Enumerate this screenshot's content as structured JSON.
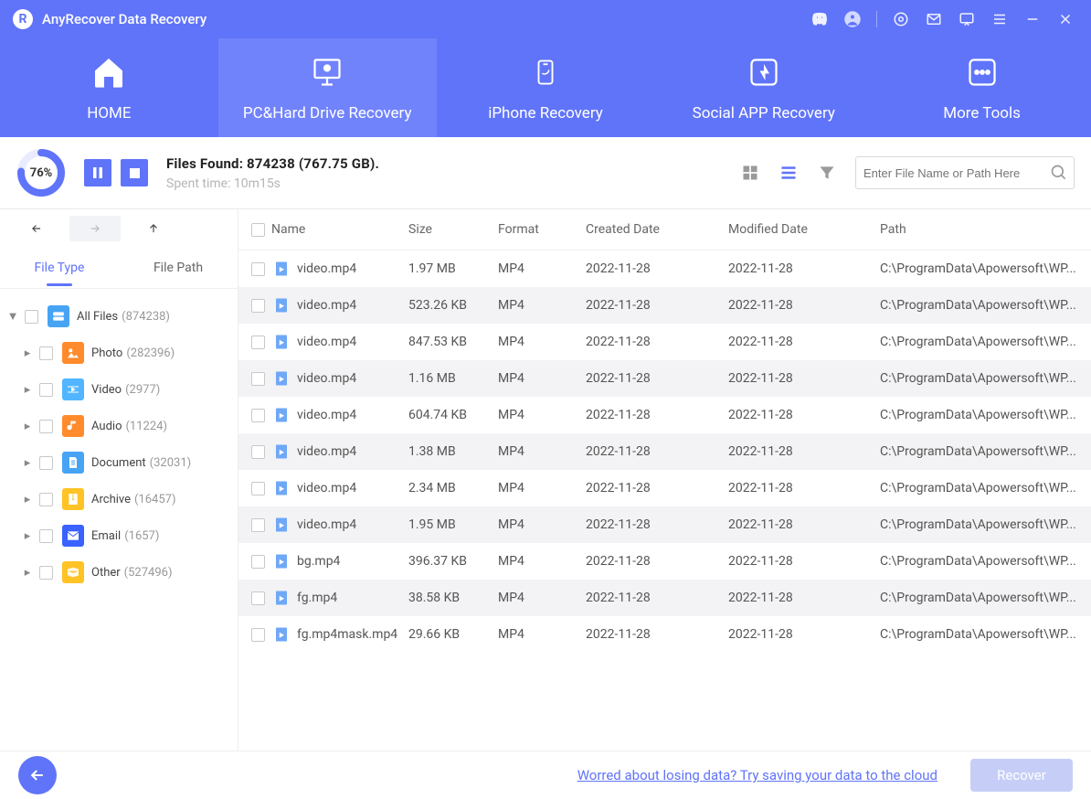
{
  "app": {
    "title": "AnyRecover Data Recovery"
  },
  "tabs": [
    {
      "label": "HOME"
    },
    {
      "label": "PC&Hard Drive Recovery"
    },
    {
      "label": "iPhone Recovery"
    },
    {
      "label": "Social APP Recovery"
    },
    {
      "label": "More Tools"
    }
  ],
  "scan": {
    "percent": "76%",
    "filesFound": "Files Found: 874238 (767.75 GB).",
    "spent": "Spent time: 10m15s",
    "percentVal": 76
  },
  "search": {
    "placeholder": "Enter File Name or Path Here"
  },
  "sidebar": {
    "tabs": [
      "File Type",
      "File Path"
    ],
    "root": {
      "label": "All Files",
      "count": "(874238)",
      "color": "#47a4f5"
    },
    "items": [
      {
        "label": "Photo",
        "count": "(282396)",
        "color": "#ff8b2c"
      },
      {
        "label": "Video",
        "count": "(2977)",
        "color": "#51b6ff"
      },
      {
        "label": "Audio",
        "count": "(11224)",
        "color": "#ff8b2c"
      },
      {
        "label": "Document",
        "count": "(32031)",
        "color": "#47a4f5"
      },
      {
        "label": "Archive",
        "count": "(16457)",
        "color": "#ffc326"
      },
      {
        "label": "Email",
        "count": "(1657)",
        "color": "#3962ff"
      },
      {
        "label": "Other",
        "count": "(527496)",
        "color": "#ffc326"
      }
    ]
  },
  "columns": {
    "name": "Name",
    "size": "Size",
    "format": "Format",
    "created": "Created Date",
    "modified": "Modified Date",
    "path": "Path"
  },
  "rows": [
    {
      "name": "video.mp4",
      "size": "1.97 MB",
      "fmt": "MP4",
      "cd": "2022-11-28",
      "md": "2022-11-28",
      "path": "C:\\ProgramData\\Apowersoft\\WP..."
    },
    {
      "name": "video.mp4",
      "size": "523.26 KB",
      "fmt": "MP4",
      "cd": "2022-11-28",
      "md": "2022-11-28",
      "path": "C:\\ProgramData\\Apowersoft\\WP..."
    },
    {
      "name": "video.mp4",
      "size": "847.53 KB",
      "fmt": "MP4",
      "cd": "2022-11-28",
      "md": "2022-11-28",
      "path": "C:\\ProgramData\\Apowersoft\\WP..."
    },
    {
      "name": "video.mp4",
      "size": "1.16 MB",
      "fmt": "MP4",
      "cd": "2022-11-28",
      "md": "2022-11-28",
      "path": "C:\\ProgramData\\Apowersoft\\WP..."
    },
    {
      "name": "video.mp4",
      "size": "604.74 KB",
      "fmt": "MP4",
      "cd": "2022-11-28",
      "md": "2022-11-28",
      "path": "C:\\ProgramData\\Apowersoft\\WP..."
    },
    {
      "name": "video.mp4",
      "size": "1.38 MB",
      "fmt": "MP4",
      "cd": "2022-11-28",
      "md": "2022-11-28",
      "path": "C:\\ProgramData\\Apowersoft\\WP..."
    },
    {
      "name": "video.mp4",
      "size": "2.34 MB",
      "fmt": "MP4",
      "cd": "2022-11-28",
      "md": "2022-11-28",
      "path": "C:\\ProgramData\\Apowersoft\\WP..."
    },
    {
      "name": "video.mp4",
      "size": "1.95 MB",
      "fmt": "MP4",
      "cd": "2022-11-28",
      "md": "2022-11-28",
      "path": "C:\\ProgramData\\Apowersoft\\WP..."
    },
    {
      "name": "bg.mp4",
      "size": "396.37 KB",
      "fmt": "MP4",
      "cd": "2022-11-28",
      "md": "2022-11-28",
      "path": "C:\\ProgramData\\Apowersoft\\WP..."
    },
    {
      "name": "fg.mp4",
      "size": "38.58 KB",
      "fmt": "MP4",
      "cd": "2022-11-28",
      "md": "2022-11-28",
      "path": "C:\\ProgramData\\Apowersoft\\WP..."
    },
    {
      "name": "fg.mp4mask.mp4",
      "size": "29.66 KB",
      "fmt": "MP4",
      "cd": "2022-11-28",
      "md": "2022-11-28",
      "path": "C:\\ProgramData\\Apowersoft\\WP..."
    }
  ],
  "footer": {
    "link": "Worred about losing data? Try saving your data to the cloud",
    "recover": "Recover"
  }
}
